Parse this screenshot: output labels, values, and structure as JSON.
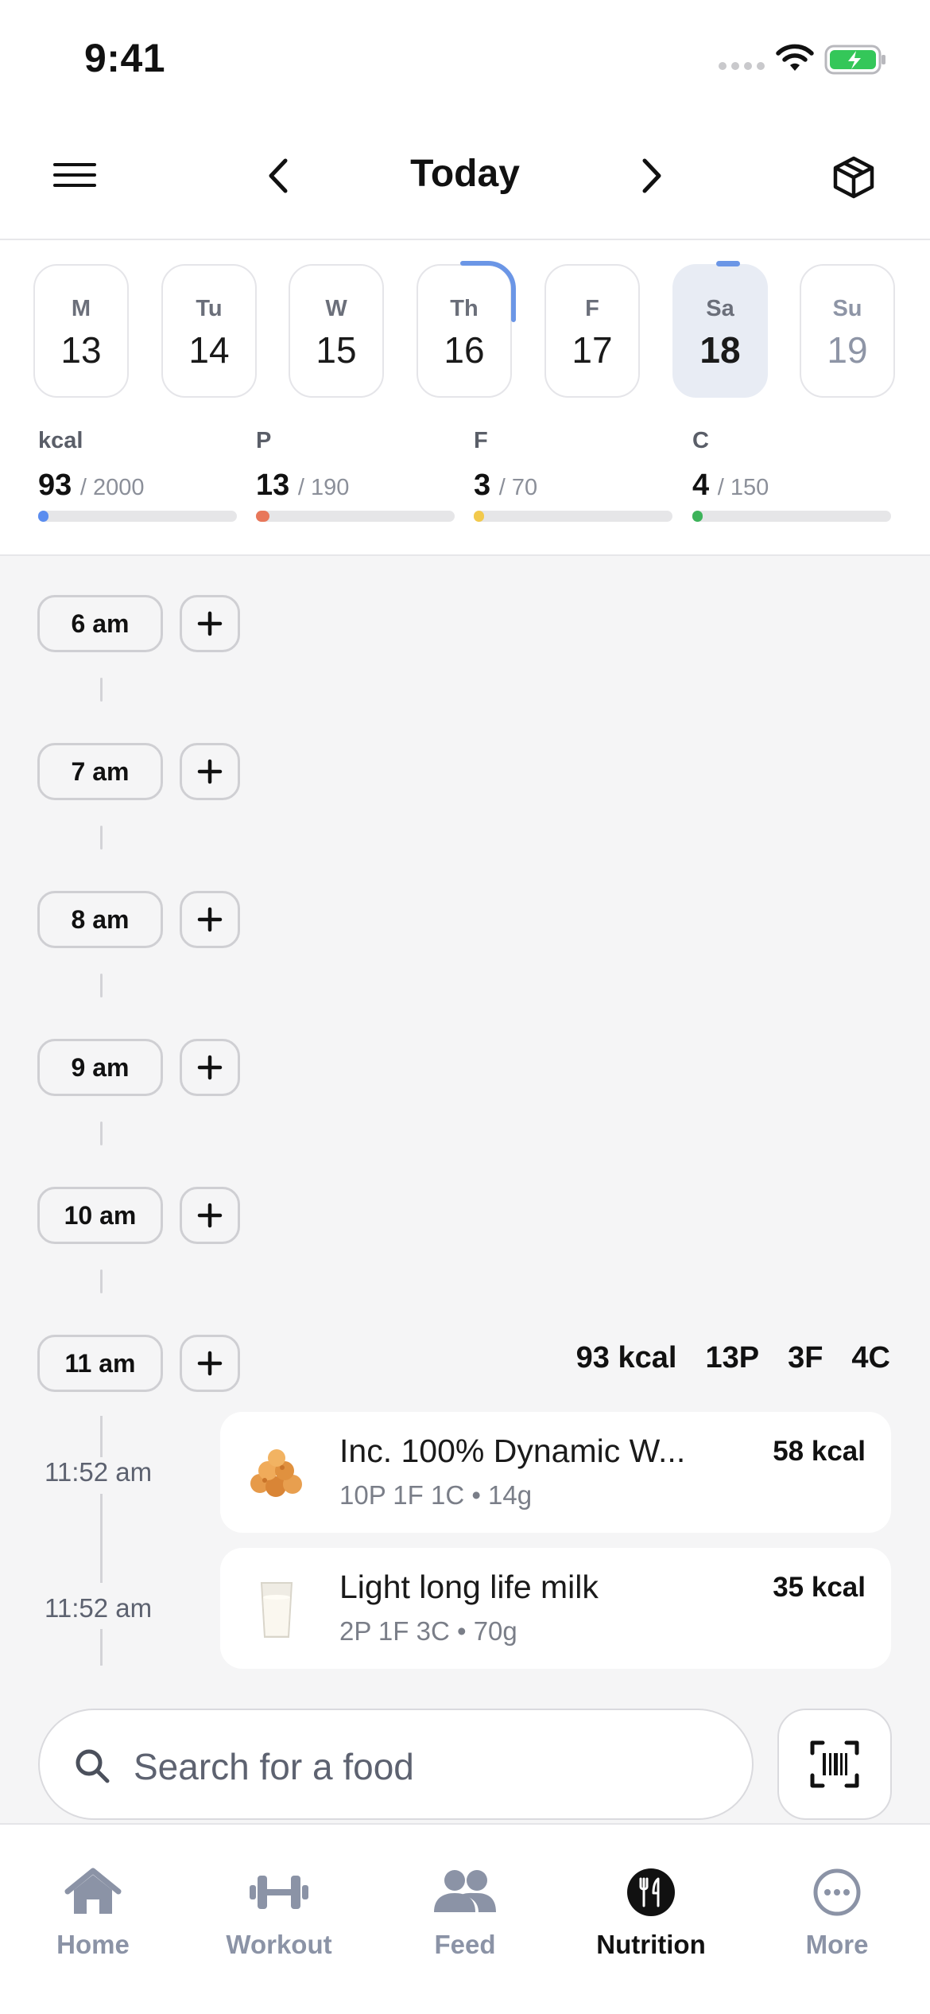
{
  "status_bar": {
    "time": "9:41"
  },
  "header": {
    "title": "Today",
    "menu_icon": "menu-icon",
    "prev_icon": "chevron-left-icon",
    "next_icon": "chevron-right-icon",
    "box_icon": "package-icon"
  },
  "days": [
    {
      "name": "M",
      "date": "13"
    },
    {
      "name": "Tu",
      "date": "14"
    },
    {
      "name": "W",
      "date": "15"
    },
    {
      "name": "Th",
      "date": "16"
    },
    {
      "name": "F",
      "date": "17"
    },
    {
      "name": "Sa",
      "date": "18"
    },
    {
      "name": "Su",
      "date": "19"
    }
  ],
  "macros": [
    {
      "label": "kcal",
      "value": "93",
      "goal": "/ 2000",
      "progress": 0.0465,
      "color": "#5b8def"
    },
    {
      "label": "P",
      "value": "13",
      "goal": "/ 190",
      "progress": 0.068,
      "color": "#e8775a"
    },
    {
      "label": "F",
      "value": "3",
      "goal": "/ 70",
      "progress": 0.043,
      "color": "#f2c94c"
    },
    {
      "label": "C",
      "value": "4",
      "goal": "/ 150",
      "progress": 0.027,
      "color": "#3db35a"
    }
  ],
  "hours": [
    "6 am",
    "7 am",
    "8 am",
    "9 am",
    "10 am",
    "11 am"
  ],
  "summary": {
    "kcal": "93 kcal",
    "protein": "13P",
    "fat": "3F",
    "carbs": "4C"
  },
  "entries": [
    {
      "time": "11:52 am",
      "name": "Inc. 100% Dynamic W...",
      "macros": "10P  1F  1C  •  14g",
      "kcal": "58 kcal",
      "image": "protein-bites-image"
    },
    {
      "time": "11:52 am",
      "name": "Light long life milk",
      "macros": "2P  1F  3C  •  70g",
      "kcal": "35 kcal",
      "image": "milk-glass-image"
    }
  ],
  "search": {
    "placeholder": "Search for a food"
  },
  "tabs": [
    {
      "label": "Home",
      "icon": "home-icon",
      "active": false
    },
    {
      "label": "Workout",
      "icon": "dumbbell-icon",
      "active": false
    },
    {
      "label": "Feed",
      "icon": "people-icon",
      "active": false
    },
    {
      "label": "Nutrition",
      "icon": "fork-knife-icon",
      "active": true
    },
    {
      "label": "More",
      "icon": "more-icon",
      "active": false
    }
  ]
}
